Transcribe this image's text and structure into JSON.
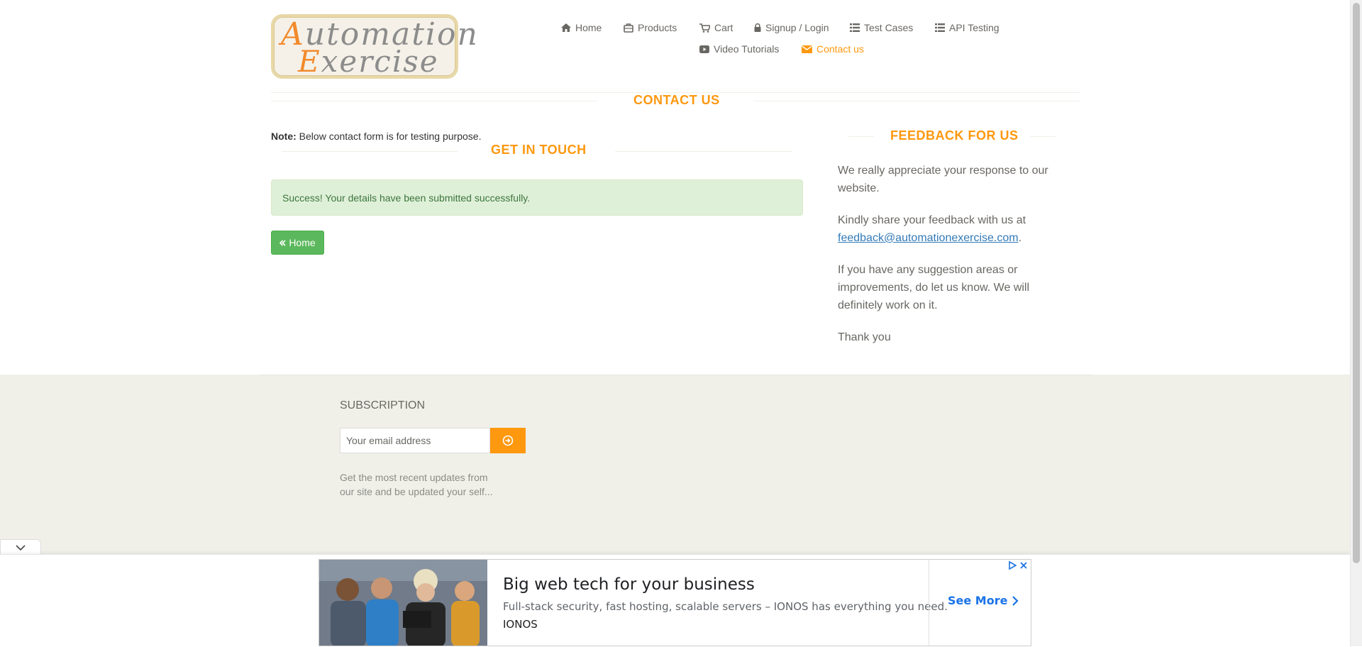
{
  "logo": {
    "line1_first": "A",
    "line1_rest": "utomation",
    "line2_first": "E",
    "line2_rest": "xercise"
  },
  "nav": [
    {
      "label": "Home",
      "icon": "home-icon"
    },
    {
      "label": "Products",
      "icon": "products-icon"
    },
    {
      "label": "Cart",
      "icon": "cart-icon"
    },
    {
      "label": "Signup / Login",
      "icon": "lock-icon"
    },
    {
      "label": "Test Cases",
      "icon": "list-icon"
    },
    {
      "label": "API Testing",
      "icon": "list-icon"
    },
    {
      "label": "Video Tutorials",
      "icon": "youtube-icon"
    },
    {
      "label": "Contact us",
      "icon": "envelope-icon",
      "active": true
    }
  ],
  "page": {
    "title": "Contact Us",
    "note_label": "Note:",
    "note_text": " Below contact form is for testing purpose.",
    "get_in_touch": "Get In Touch",
    "success_message": "Success! Your details have been submitted successfully.",
    "home_button": "Home"
  },
  "feedback": {
    "title": "Feedback For Us",
    "p1": "We really appreciate your response to our website.",
    "p2_prefix": "Kindly share your feedback with us at ",
    "p2_email": "feedback@automationexercise.com",
    "p2_suffix": ".",
    "p3": "If you have any suggestion areas or improvements, do let us know. We will definitely work on it.",
    "p4": "Thank you"
  },
  "footer": {
    "subscription_title": "Subscription",
    "email_placeholder": "Your email address",
    "description": "Get the most recent updates from our site and be updated your self..."
  },
  "ad": {
    "headline": "Big web tech for your business",
    "description": "Full-stack security, fast hosting, scalable servers – IONOS has everything you need.",
    "brand": "IONOS",
    "cta": "See More"
  },
  "colors": {
    "accent": "#FE980F",
    "success_bg": "#dff0d8",
    "success_text": "#3c763d",
    "button_green": "#5cb85c",
    "footer_bg": "#f0f0e9",
    "link": "#337ab7"
  }
}
